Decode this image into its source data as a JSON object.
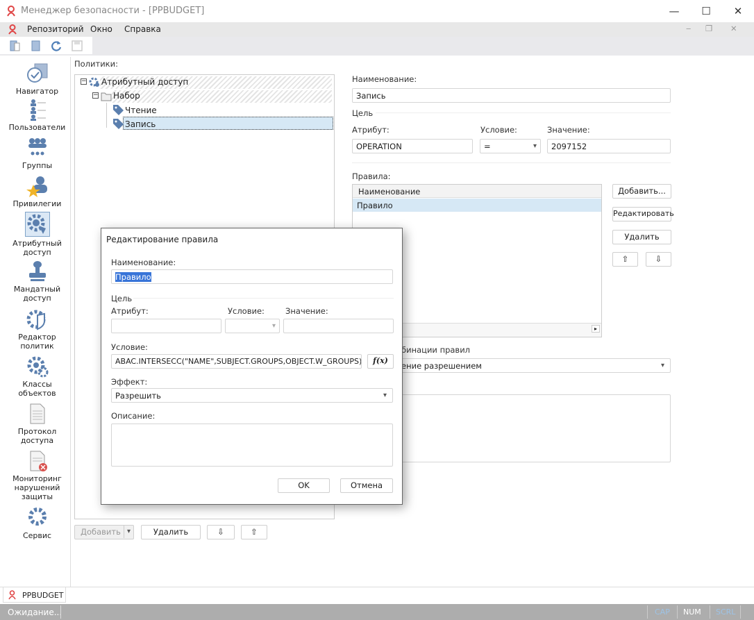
{
  "window": {
    "title": "Менеджер безопасности - [PPBUDGET]",
    "minimize": "—",
    "maximize": "☐",
    "close": "✕"
  },
  "menu": {
    "items": [
      "Репозиторий",
      "Окно",
      "Справка"
    ],
    "mdi_controls": [
      "‒",
      "❐",
      "✕"
    ]
  },
  "toolbar": {
    "icons": [
      "new-object-icon",
      "open-icon",
      "refresh-icon",
      "save-icon"
    ]
  },
  "nav": {
    "items": [
      {
        "label": "Навигатор",
        "icon": "navigator-icon"
      },
      {
        "label": "Пользователи",
        "icon": "users-icon"
      },
      {
        "label": "Группы",
        "icon": "groups-icon"
      },
      {
        "label": "Привилегии",
        "icon": "privileges-icon"
      },
      {
        "label": "Атрибутный доступ",
        "icon": "attribute-access-icon"
      },
      {
        "label": "Мандатный доступ",
        "icon": "mandatory-access-icon"
      },
      {
        "label": "Редактор политик",
        "icon": "policy-editor-icon"
      },
      {
        "label": "Классы объектов",
        "icon": "object-classes-icon"
      },
      {
        "label": "Протокол доступа",
        "icon": "access-log-icon"
      },
      {
        "label": "Мониторинг нарушений защиты",
        "icon": "violations-monitor-icon"
      },
      {
        "label": "Сервис",
        "icon": "service-icon"
      }
    ]
  },
  "policies": {
    "label": "Политики:",
    "tree": {
      "root": "Атрибутный доступ",
      "set": "Набор",
      "items": [
        "Чтение",
        "Запись"
      ],
      "selected": "Запись"
    },
    "buttons": {
      "add": "Добавить",
      "delete": "Удалить",
      "down": "⇩",
      "up": "⇧"
    }
  },
  "policy": {
    "name_label": "Наименование:",
    "name_value": "Запись",
    "target_label": "Цель",
    "attribute_label": "Атрибут:",
    "attribute_value": "OPERATION",
    "condition_label": "Условие:",
    "condition_value": "=",
    "value_label": "Значение:",
    "value_value": "2097152",
    "rules_label": "Правила:",
    "rules_column": "Наименование",
    "rules": [
      "Правило"
    ],
    "rule_buttons": {
      "add": "Добавить...",
      "edit": "Редактировать",
      "delete": "Удалить",
      "up": "⇧",
      "down": "⇩"
    },
    "combination_label_visible": "бинации правил",
    "combination_value_visible": "ение разрешением"
  },
  "dialog": {
    "title": "Редактирование правила",
    "name_label": "Наименование:",
    "name_value": "Правило",
    "target_label": "Цель",
    "attribute_label": "Атрибут:",
    "attribute_value": "",
    "condition_label": "Условие:",
    "condition_value": "",
    "value_label": "Значение:",
    "value_value": "",
    "expr_label": "Условие:",
    "expr_value": "ABAC.INTERSECC(\"NAME\",SUBJECT.GROUPS,OBJECT.W_GROUPS) And",
    "fx": "f(x)",
    "effect_label": "Эффект:",
    "effect_value": "Разрешить",
    "description_label": "Описание:",
    "description_value": "",
    "ok": "OK",
    "cancel": "Отмена"
  },
  "tabs": [
    "PPBUDGET"
  ],
  "status": {
    "text": "Ожидание...",
    "cap": "CAP",
    "num": "NUM",
    "scrl": "SCRL"
  },
  "colors": {
    "selection": "#d6e8f5",
    "status_bg": "#adadad",
    "icon_blue": "#5b7fae"
  }
}
